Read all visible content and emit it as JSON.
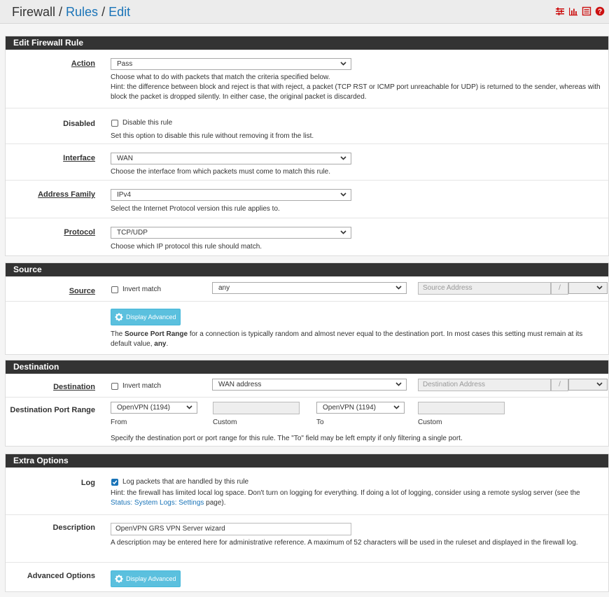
{
  "header": {
    "crumb_root": "Firewall",
    "sep1": " / ",
    "crumb_rules": "Rules",
    "sep2": " / ",
    "crumb_edit": "Edit",
    "icons": [
      "sliders-icon",
      "bar-chart-icon",
      "list-icon",
      "help-icon"
    ]
  },
  "edit_rule": {
    "title": "Edit Firewall Rule",
    "action": {
      "label": "Action",
      "value": "Pass",
      "help1": "Choose what to do with packets that match the criteria specified below.",
      "help2": "Hint: the difference between block and reject is that with reject, a packet (TCP RST or ICMP port unreachable for UDP) is returned to the sender, whereas with block the packet is dropped silently. In either case, the original packet is discarded."
    },
    "disabled": {
      "label": "Disabled",
      "checkbox_label": "Disable this rule",
      "help": "Set this option to disable this rule without removing it from the list."
    },
    "interface": {
      "label": "Interface",
      "value": "WAN",
      "help": "Choose the interface from which packets must come to match this rule."
    },
    "address_family": {
      "label": "Address Family",
      "value": "IPv4",
      "help": "Select the Internet Protocol version this rule applies to."
    },
    "protocol": {
      "label": "Protocol",
      "value": "TCP/UDP",
      "help": "Choose which IP protocol this rule should match."
    }
  },
  "source": {
    "title": "Source",
    "label": "Source",
    "invert_label": "Invert match",
    "type_value": "any",
    "address_placeholder": "Source Address",
    "slash": "/",
    "advanced_button": "Display Advanced",
    "help_pre": "The ",
    "help_bold": "Source Port Range",
    "help_mid": " for a connection is typically random and almost never equal to the destination port. In most cases this setting must remain at its default value, ",
    "help_bold2": "any",
    "help_post": "."
  },
  "destination": {
    "title": "Destination",
    "label": "Destination",
    "invert_label": "Invert match",
    "type_value": "WAN address",
    "address_placeholder": "Destination Address",
    "slash": "/",
    "port_range_label": "Destination Port Range",
    "from_value": "OpenVPN (1194)",
    "to_value": "OpenVPN (1194)",
    "from_label": "From",
    "custom_label1": "Custom",
    "to_label": "To",
    "custom_label2": "Custom",
    "help": "Specify the destination port or port range for this rule. The \"To\" field may be left empty if only filtering a single port."
  },
  "extra": {
    "title": "Extra Options",
    "log": {
      "label": "Log",
      "checkbox_label": "Log packets that are handled by this rule",
      "checked": true,
      "help_pre": "Hint: the firewall has limited local log space. Don't turn on logging for everything. If doing a lot of logging, consider using a remote syslog server (see the ",
      "help_link": "Status: System Logs: Settings",
      "help_post": " page)."
    },
    "description": {
      "label": "Description",
      "value": "OpenVPN GRS VPN Server wizard",
      "help": "A description may be entered here for administrative reference. A maximum of 52 characters will be used in the ruleset and displayed in the firewall log."
    },
    "advanced": {
      "label": "Advanced Options",
      "button": "Display Advanced"
    }
  },
  "colors": {
    "accent": "#1a74b8",
    "panel_header": "#333333",
    "info_button": "#5bc0de",
    "icon_red": "#cc1111"
  }
}
